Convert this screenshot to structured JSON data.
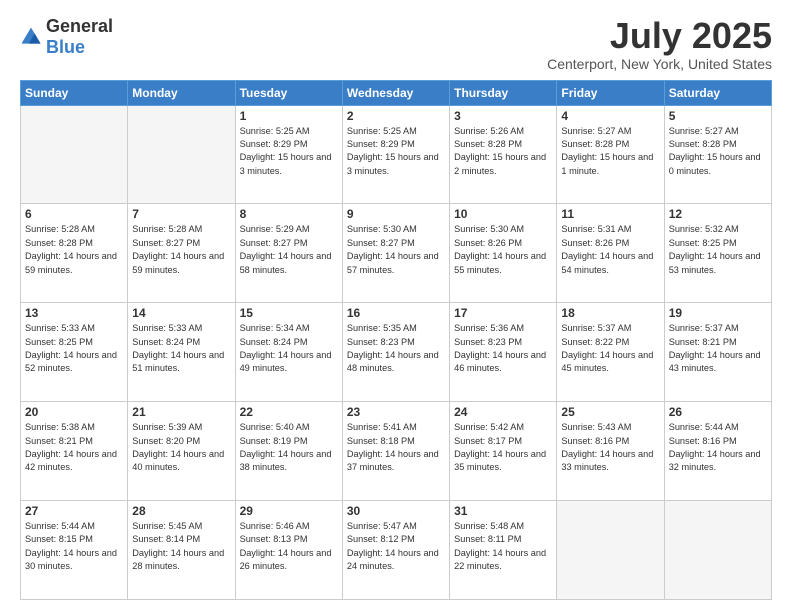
{
  "header": {
    "logo_general": "General",
    "logo_blue": "Blue",
    "title": "July 2025",
    "location": "Centerport, New York, United States"
  },
  "days_of_week": [
    "Sunday",
    "Monday",
    "Tuesday",
    "Wednesday",
    "Thursday",
    "Friday",
    "Saturday"
  ],
  "weeks": [
    [
      {
        "day": "",
        "empty": true
      },
      {
        "day": "",
        "empty": true
      },
      {
        "day": "1",
        "sunrise": "Sunrise: 5:25 AM",
        "sunset": "Sunset: 8:29 PM",
        "daylight": "Daylight: 15 hours and 3 minutes."
      },
      {
        "day": "2",
        "sunrise": "Sunrise: 5:25 AM",
        "sunset": "Sunset: 8:29 PM",
        "daylight": "Daylight: 15 hours and 3 minutes."
      },
      {
        "day": "3",
        "sunrise": "Sunrise: 5:26 AM",
        "sunset": "Sunset: 8:28 PM",
        "daylight": "Daylight: 15 hours and 2 minutes."
      },
      {
        "day": "4",
        "sunrise": "Sunrise: 5:27 AM",
        "sunset": "Sunset: 8:28 PM",
        "daylight": "Daylight: 15 hours and 1 minute."
      },
      {
        "day": "5",
        "sunrise": "Sunrise: 5:27 AM",
        "sunset": "Sunset: 8:28 PM",
        "daylight": "Daylight: 15 hours and 0 minutes."
      }
    ],
    [
      {
        "day": "6",
        "sunrise": "Sunrise: 5:28 AM",
        "sunset": "Sunset: 8:28 PM",
        "daylight": "Daylight: 14 hours and 59 minutes."
      },
      {
        "day": "7",
        "sunrise": "Sunrise: 5:28 AM",
        "sunset": "Sunset: 8:27 PM",
        "daylight": "Daylight: 14 hours and 59 minutes."
      },
      {
        "day": "8",
        "sunrise": "Sunrise: 5:29 AM",
        "sunset": "Sunset: 8:27 PM",
        "daylight": "Daylight: 14 hours and 58 minutes."
      },
      {
        "day": "9",
        "sunrise": "Sunrise: 5:30 AM",
        "sunset": "Sunset: 8:27 PM",
        "daylight": "Daylight: 14 hours and 57 minutes."
      },
      {
        "day": "10",
        "sunrise": "Sunrise: 5:30 AM",
        "sunset": "Sunset: 8:26 PM",
        "daylight": "Daylight: 14 hours and 55 minutes."
      },
      {
        "day": "11",
        "sunrise": "Sunrise: 5:31 AM",
        "sunset": "Sunset: 8:26 PM",
        "daylight": "Daylight: 14 hours and 54 minutes."
      },
      {
        "day": "12",
        "sunrise": "Sunrise: 5:32 AM",
        "sunset": "Sunset: 8:25 PM",
        "daylight": "Daylight: 14 hours and 53 minutes."
      }
    ],
    [
      {
        "day": "13",
        "sunrise": "Sunrise: 5:33 AM",
        "sunset": "Sunset: 8:25 PM",
        "daylight": "Daylight: 14 hours and 52 minutes."
      },
      {
        "day": "14",
        "sunrise": "Sunrise: 5:33 AM",
        "sunset": "Sunset: 8:24 PM",
        "daylight": "Daylight: 14 hours and 51 minutes."
      },
      {
        "day": "15",
        "sunrise": "Sunrise: 5:34 AM",
        "sunset": "Sunset: 8:24 PM",
        "daylight": "Daylight: 14 hours and 49 minutes."
      },
      {
        "day": "16",
        "sunrise": "Sunrise: 5:35 AM",
        "sunset": "Sunset: 8:23 PM",
        "daylight": "Daylight: 14 hours and 48 minutes."
      },
      {
        "day": "17",
        "sunrise": "Sunrise: 5:36 AM",
        "sunset": "Sunset: 8:23 PM",
        "daylight": "Daylight: 14 hours and 46 minutes."
      },
      {
        "day": "18",
        "sunrise": "Sunrise: 5:37 AM",
        "sunset": "Sunset: 8:22 PM",
        "daylight": "Daylight: 14 hours and 45 minutes."
      },
      {
        "day": "19",
        "sunrise": "Sunrise: 5:37 AM",
        "sunset": "Sunset: 8:21 PM",
        "daylight": "Daylight: 14 hours and 43 minutes."
      }
    ],
    [
      {
        "day": "20",
        "sunrise": "Sunrise: 5:38 AM",
        "sunset": "Sunset: 8:21 PM",
        "daylight": "Daylight: 14 hours and 42 minutes."
      },
      {
        "day": "21",
        "sunrise": "Sunrise: 5:39 AM",
        "sunset": "Sunset: 8:20 PM",
        "daylight": "Daylight: 14 hours and 40 minutes."
      },
      {
        "day": "22",
        "sunrise": "Sunrise: 5:40 AM",
        "sunset": "Sunset: 8:19 PM",
        "daylight": "Daylight: 14 hours and 38 minutes."
      },
      {
        "day": "23",
        "sunrise": "Sunrise: 5:41 AM",
        "sunset": "Sunset: 8:18 PM",
        "daylight": "Daylight: 14 hours and 37 minutes."
      },
      {
        "day": "24",
        "sunrise": "Sunrise: 5:42 AM",
        "sunset": "Sunset: 8:17 PM",
        "daylight": "Daylight: 14 hours and 35 minutes."
      },
      {
        "day": "25",
        "sunrise": "Sunrise: 5:43 AM",
        "sunset": "Sunset: 8:16 PM",
        "daylight": "Daylight: 14 hours and 33 minutes."
      },
      {
        "day": "26",
        "sunrise": "Sunrise: 5:44 AM",
        "sunset": "Sunset: 8:16 PM",
        "daylight": "Daylight: 14 hours and 32 minutes."
      }
    ],
    [
      {
        "day": "27",
        "sunrise": "Sunrise: 5:44 AM",
        "sunset": "Sunset: 8:15 PM",
        "daylight": "Daylight: 14 hours and 30 minutes."
      },
      {
        "day": "28",
        "sunrise": "Sunrise: 5:45 AM",
        "sunset": "Sunset: 8:14 PM",
        "daylight": "Daylight: 14 hours and 28 minutes."
      },
      {
        "day": "29",
        "sunrise": "Sunrise: 5:46 AM",
        "sunset": "Sunset: 8:13 PM",
        "daylight": "Daylight: 14 hours and 26 minutes."
      },
      {
        "day": "30",
        "sunrise": "Sunrise: 5:47 AM",
        "sunset": "Sunset: 8:12 PM",
        "daylight": "Daylight: 14 hours and 24 minutes."
      },
      {
        "day": "31",
        "sunrise": "Sunrise: 5:48 AM",
        "sunset": "Sunset: 8:11 PM",
        "daylight": "Daylight: 14 hours and 22 minutes."
      },
      {
        "day": "",
        "empty": true
      },
      {
        "day": "",
        "empty": true
      }
    ]
  ]
}
